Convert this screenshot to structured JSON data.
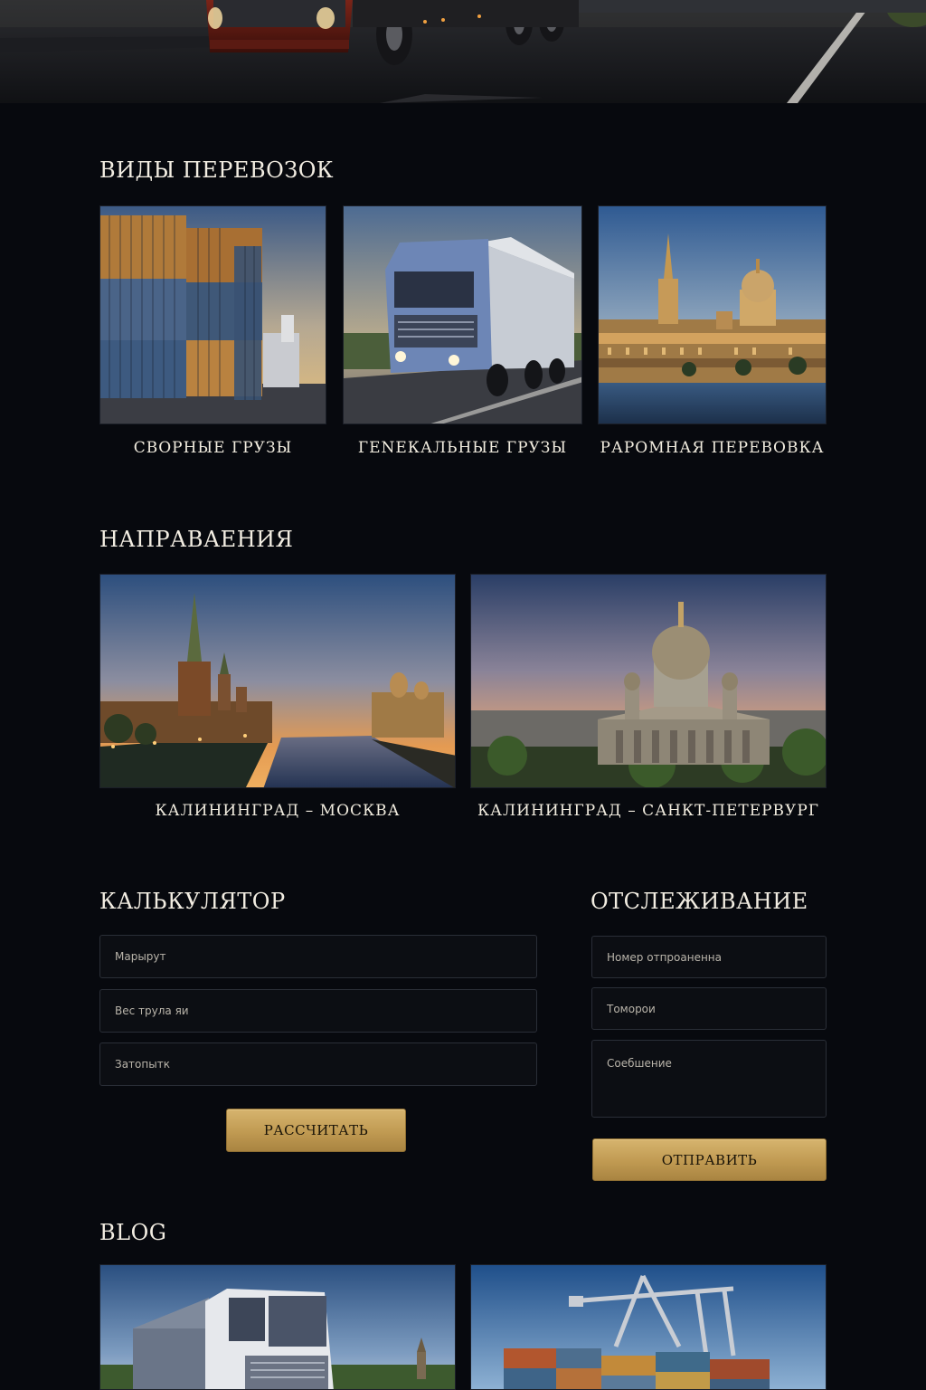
{
  "sections": {
    "services_title": "ВИДЫ ПЕРЕВОЗОК",
    "directions_title": "НАПРАВАЕНИЯ",
    "calculator_title": "КАЛЬКУЛЯТОР",
    "tracking_title": "ОТСЛЕЖИВАНИЕ",
    "blog_title": "BLOG"
  },
  "services": [
    {
      "label": "СВОРНЫЕ ГРУЗЫ",
      "icon": "containers-image"
    },
    {
      "label": "ГЕNЕКАЛЬНЫЕ ГРУЗЫ",
      "icon": "truck-image"
    },
    {
      "label": "РАРОМНАЯ ПЕРЕВОВКА",
      "icon": "city-embankment-image"
    }
  ],
  "directions": [
    {
      "label": "КАЛИНИНГРАД – МОСКВА",
      "icon": "moscow-kremlin-image"
    },
    {
      "label": "КАЛИНИНГРАД – САНКТ-ПЕТЕРВУРГ",
      "icon": "st-petersburg-cathedral-image"
    }
  ],
  "calculator": {
    "fields": [
      {
        "placeholder": "Марырут"
      },
      {
        "placeholder": "Вес трула яи"
      },
      {
        "placeholder": "Затопытк"
      }
    ],
    "button_label": "РАССЧИТАТЬ"
  },
  "tracking": {
    "fields": [
      {
        "placeholder": "Номер отпроаненна"
      },
      {
        "placeholder": "Томорои"
      },
      {
        "placeholder": "Соебшение"
      }
    ],
    "button_label": "ОТПРАВИТЬ"
  },
  "blog": [
    {
      "icon": "truck-blog-image"
    },
    {
      "icon": "port-crane-blog-image"
    }
  ],
  "colors": {
    "background": "#07090e",
    "accent_gold": "#c9a45c",
    "text": "#ece6d8"
  }
}
